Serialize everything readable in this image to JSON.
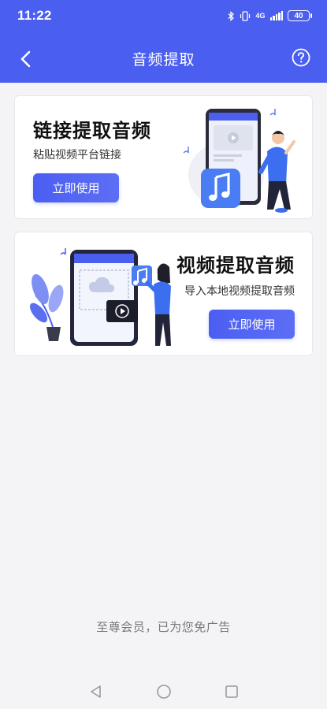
{
  "status_bar": {
    "time": "11:22",
    "network": "4G",
    "battery": "40"
  },
  "header": {
    "title": "音频提取",
    "back_icon": "chevron-left-icon",
    "help_icon": "question-circle-icon",
    "background_color": "#4a5ef0"
  },
  "cards": [
    {
      "title": "链接提取音频",
      "subtitle": "粘贴视频平台链接",
      "button_label": "立即使用",
      "illustration": "phone-with-music-note-person-illustration"
    },
    {
      "title": "视频提取音频",
      "subtitle": "导入本地视频提取音频",
      "button_label": "立即使用",
      "illustration": "phone-video-upload-person-illustration"
    }
  ],
  "footer": {
    "vip_note": "至尊会员，已为您免广告"
  },
  "system_nav": {
    "back_icon": "triangle-back-icon",
    "home_icon": "circle-home-icon",
    "recents_icon": "square-recents-icon"
  },
  "colors": {
    "accent": "#4a5ef0",
    "button": "#4b5ef2"
  }
}
